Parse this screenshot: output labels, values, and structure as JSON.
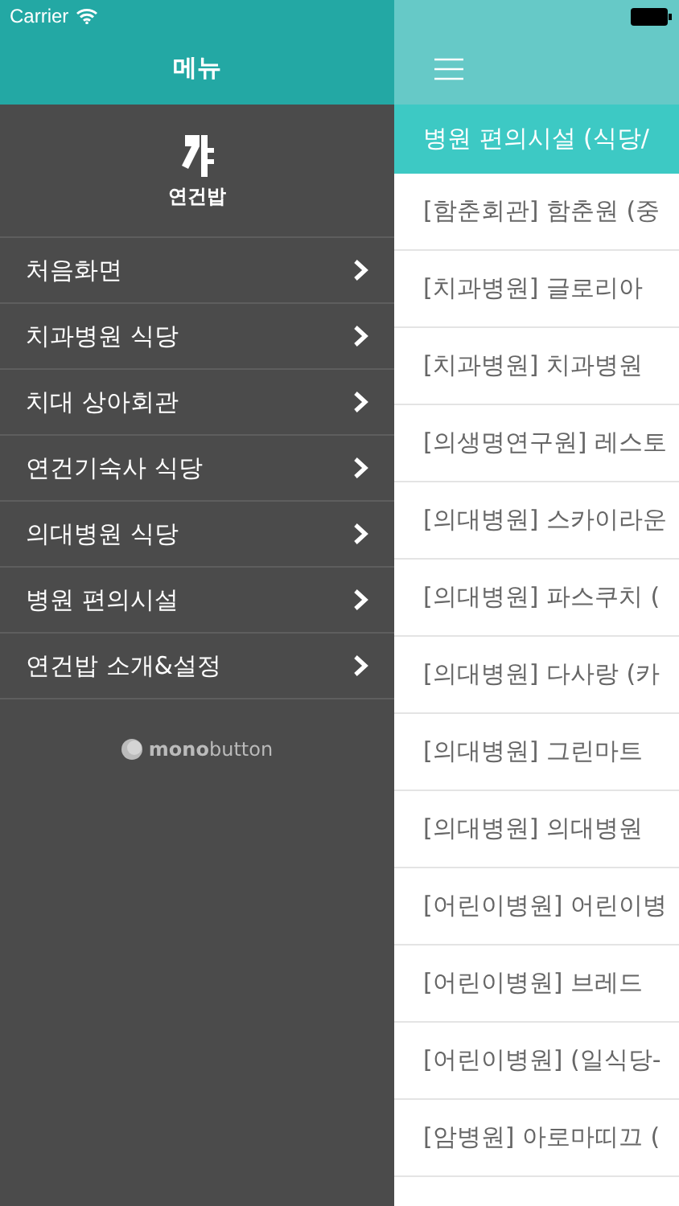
{
  "status_bar": {
    "carrier": "Carrier"
  },
  "menu": {
    "title": "메뉴",
    "logo_text": "연건밥",
    "items": [
      {
        "label": "처음화면"
      },
      {
        "label": "치과병원 식당"
      },
      {
        "label": "치대 상아회관"
      },
      {
        "label": "연건기숙사 식당"
      },
      {
        "label": "의대병원 식당"
      },
      {
        "label": "병원 편의시설"
      },
      {
        "label": "연건밥 소개&설정"
      }
    ],
    "footer": "**mono**button"
  },
  "content": {
    "section_title": "병원 편의시설 (식당/",
    "rows": [
      "[함춘회관] 함춘원 (중",
      "[치과병원] 글로리아",
      "[치과병원] 치과병원",
      "[의생명연구원] 레스토",
      "[의대병원] 스카이라운",
      "[의대병원] 파스쿠치 (",
      "[의대병원] 다사랑 (카",
      "[의대병원] 그린마트",
      "[의대병원] 의대병원",
      "[어린이병원] 어린이병",
      "[어린이병원] 브레드",
      "[어린이병원] (일식당-",
      "[암병원] 아로마띠끄 ("
    ]
  }
}
